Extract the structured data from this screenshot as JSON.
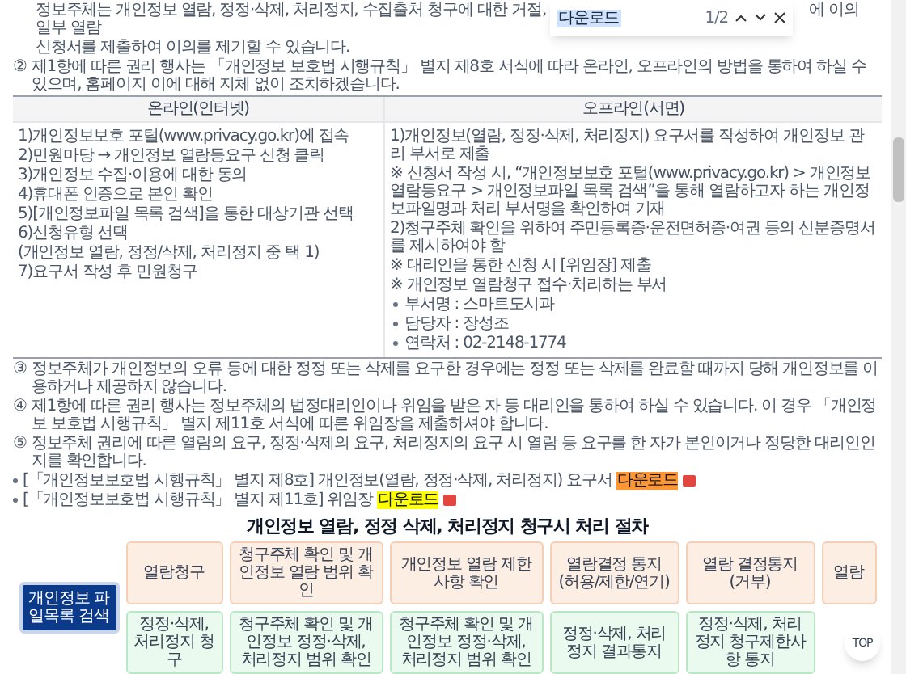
{
  "find_bar": {
    "query": "다운로드",
    "count": "1/2"
  },
  "intro": {
    "before": "정보주체는 개인정보 열람, 정정·삭제, 처리정지, 수집출처 청구에 대한 거절, 일부 열람",
    "after": "에 이의",
    "rest": "신청서를 제출하여 이의를 제기할 수 있습니다."
  },
  "paragraphs_top": [
    {
      "marker": "②",
      "text": "제1항에 따른 권리 행사는 「개인정보 보호법 시행규칙」 별지 제8호 서식에 따라 온라인, 오프라인의 방법을 통하여 하실 수 있으며, 홈페이지 이에 대해 지체 없이 조치하겠습니다."
    }
  ],
  "table": {
    "columns": [
      "온라인(인터넷)",
      "오프라인(서면)"
    ],
    "online": [
      "1)개인정보보호 포털(www.privacy.go.kr)에 접속",
      "2)민원마당 → 개인정보 열람등요구 신청 클릭",
      "3)개인정보 수집·이용에 대한 동의",
      "4)휴대폰 인증으로 본인 확인",
      "5)[개인정보파일 목록 검색]을 통한 대상기관 선택",
      "6)신청유형 선택",
      "(개인정보 열람, 정정/삭제, 처리정지 중 택 1)",
      "7)요구서 작성 후 민원청구"
    ],
    "offline": [
      {
        "kind": "text",
        "text": "1)개인정보(열람, 정정·삭제, 처리정지) 요구서를 작성하여 개인정보 관리 부서로 제출"
      },
      {
        "kind": "text",
        "text": "※ 신청서 작성 시, “개인정보보호 포털(www.privacy.go.kr) > 개인정보 열람등요구 > 개인정보파일 목록 검색”을 통해 열람하고자 하는 개인정보파일명과 처리 부서명을 확인하여 기재"
      },
      {
        "kind": "text",
        "text": "2)청구주체 확인을 위하여 주민등록증·운전면허증·여권 등의 신분증명서를 제시하여야 함"
      },
      {
        "kind": "text",
        "text": "※ 대리인을 통한 신청 시 [위임장] 제출"
      },
      {
        "kind": "text",
        "text": "※ 개인정보 열람청구 접수·처리하는 부서"
      },
      {
        "kind": "bullet",
        "text": "부서명 : 스마트도시과"
      },
      {
        "kind": "bullet",
        "text": "담당자 : 장성조"
      },
      {
        "kind": "bullet",
        "text": "연락처 : 02-2148-1774"
      }
    ]
  },
  "paragraphs": [
    {
      "marker": "③",
      "text": "정보주체가 개인정보의 오류 등에 대한 정정 또는 삭제를 요구한 경우에는 정정 또는 삭제를 완료할 때까지 당해 개인정보를 이용하거나 제공하지 않습니다."
    },
    {
      "marker": "④",
      "text": "제1항에 따른 권리 행사는 정보주체의 법정대리인이나 위임을 받은 자 등 대리인을 통하여 하실 수 있습니다. 이 경우 「개인정보 보호법 시행규칙」 별지 제11호 서식에 따른 위임장을 제출하셔야 합니다."
    },
    {
      "marker": "⑤",
      "text": "정보주체 권리에 따른 열람의 요구, 정정·삭제의 요구, 처리정지의 요구 시 열람 등 요구를 한 자가 본인이거나 정당한 대리인인지를 확인합니다."
    }
  ],
  "downloads": [
    {
      "text": "[「개인정보보호법 시행규칙」 별지 제8호] 개인정보(열람, 정정·삭제, 처리정지) 요구서",
      "link": "다운로드",
      "selected": true
    },
    {
      "text": "[「개인정보보호법 시행규칙」 별지 제11호] 위임장",
      "link": "다운로드",
      "selected": false
    }
  ],
  "procedure": {
    "title": "개인정보 열람, 정정 삭제, 처리정지 청구시 처리 절차",
    "start": "개인정보 파일목록 검색",
    "left": {
      "steps": [
        "열람청구",
        "청구주체 확인 및 개인정보 열람 범위 확인",
        "개인정보 열람 제한사항 확인"
      ],
      "outcomes": [
        "열람결정 통지 (허용/제한/연기)",
        "열람 결정통지(거부)"
      ],
      "final": "열람"
    },
    "right": {
      "steps": [
        "정정·삭제, 처리정지 청구",
        "청구주체 확인 및 개인정보 정정·삭제, 처리정지 범위 확인",
        "청구주체 확인 및 개인정보 정정·삭제, 처리정지 범위 확인"
      ],
      "outcomes": [
        "정정·삭제, 처리정지 결과통지",
        "정정·삭제, 처리정지 청구제한사항 통지"
      ]
    }
  },
  "top_button": "TOP"
}
